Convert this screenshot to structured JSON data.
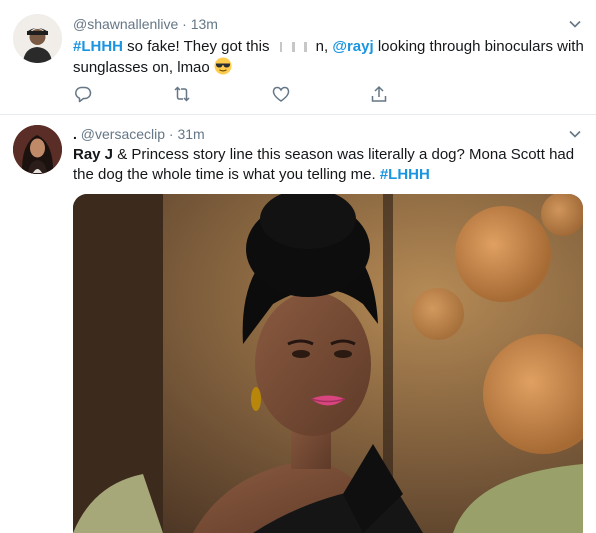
{
  "tweets": [
    {
      "handle": "@shawnallenlive",
      "sep": "·",
      "time": "13m",
      "text": {
        "hashtag": "#LHHH",
        "part1": " so fake! They got this ",
        "part2": "n, ",
        "mention": "@rayj",
        "part3": " looking through binoculars with sunglasses on, lmao "
      },
      "emoji_icon": "sunglasses-face-emoji"
    },
    {
      "display_name": ".",
      "handle": "@versaceclip",
      "sep": "·",
      "time": "31m",
      "text": {
        "lead": "Ray J",
        "part1": " & Princess story line this season was literally a dog? Mona Scott had the dog the whole time is what you telling me. ",
        "hashtag": "#LHHH"
      },
      "media_icon": "attached-gif-image"
    }
  ],
  "colors": {
    "accent": "#1b95e0",
    "secondary_text": "#657786",
    "divider": "#e6ecf0"
  },
  "icons": [
    "reply-icon",
    "retweet-icon",
    "like-icon",
    "share-icon",
    "chevron-down-icon"
  ]
}
